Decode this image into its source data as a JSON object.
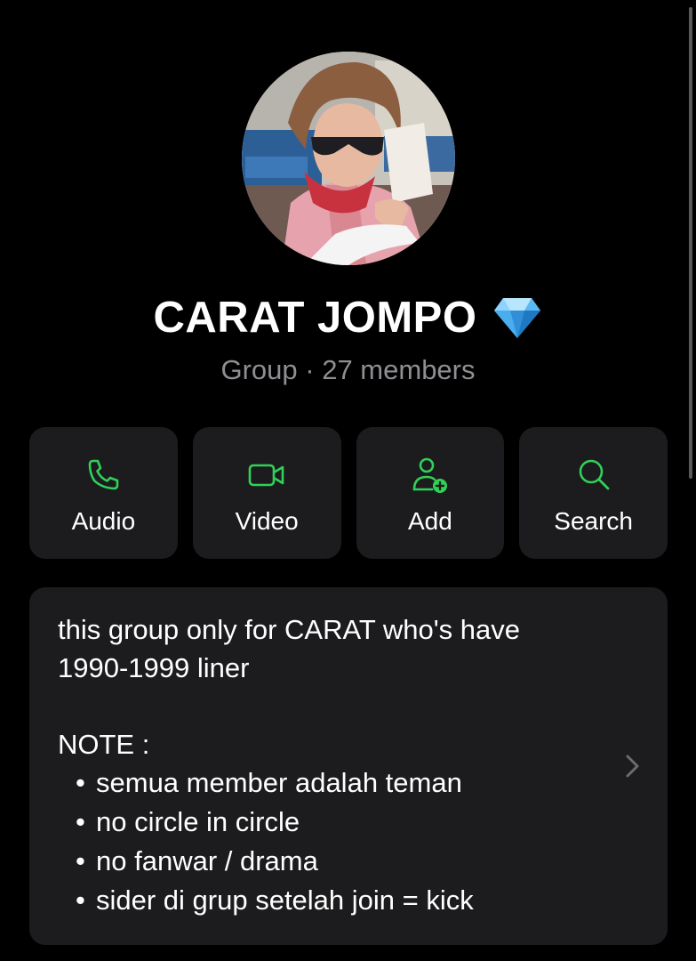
{
  "group": {
    "name": "CARAT JOMPO",
    "subtitle": "Group · 27 members"
  },
  "actions": [
    {
      "label": "Audio",
      "icon": "phone-icon"
    },
    {
      "label": "Video",
      "icon": "video-camera-icon"
    },
    {
      "label": "Add",
      "icon": "add-member-icon"
    },
    {
      "label": "Search",
      "icon": "search-icon"
    }
  ],
  "description": {
    "lines": [
      "this group only for CARAT who's have",
      "1990-1999 liner"
    ],
    "note_heading": "NOTE :",
    "notes": [
      "semua member adalah teman",
      "no circle in circle",
      "no fanwar / drama",
      "sider di grup setelah join = kick"
    ]
  },
  "colors": {
    "background": "#000000",
    "card": "#1c1c1e",
    "accent_green": "#30d158",
    "secondary_text": "#8e8e93"
  }
}
